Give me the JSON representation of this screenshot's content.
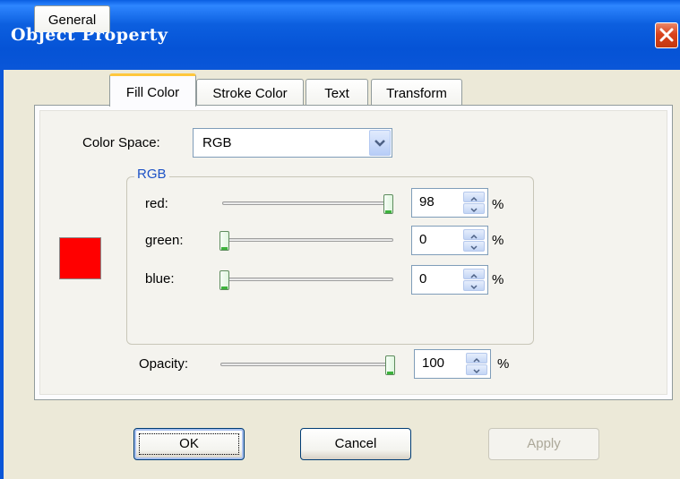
{
  "window": {
    "title": "Object Property"
  },
  "tabs": [
    {
      "label": "General"
    },
    {
      "label": "Fill Color"
    },
    {
      "label": "Stroke Color"
    },
    {
      "label": "Text"
    },
    {
      "label": "Transform"
    }
  ],
  "active_tab": "Fill Color",
  "color_space": {
    "label": "Color Space:",
    "value": "RGB"
  },
  "rgb_group": {
    "title": "RGB",
    "channels": [
      {
        "label": "red:",
        "value": "98",
        "unit": "%"
      },
      {
        "label": "green:",
        "value": "0",
        "unit": "%"
      },
      {
        "label": "blue:",
        "value": "0",
        "unit": "%"
      }
    ]
  },
  "opacity": {
    "label": "Opacity:",
    "value": "100",
    "unit": "%"
  },
  "swatch_color": "#ff0000",
  "buttons": {
    "ok": "OK",
    "cancel": "Cancel",
    "apply": "Apply"
  },
  "icons": {
    "close": "close-icon",
    "dropdown": "chevron-down-icon",
    "spin_up": "arrow-up-icon",
    "spin_down": "arrow-down-icon"
  }
}
